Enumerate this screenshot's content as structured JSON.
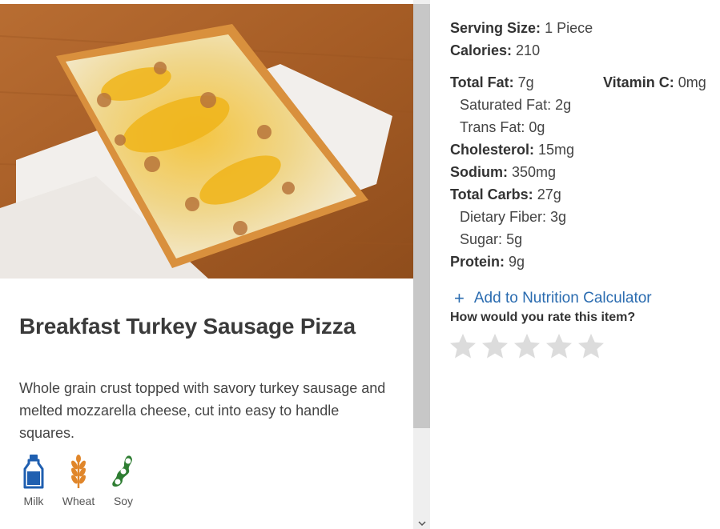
{
  "item": {
    "title": "Breakfast Turkey Sausage Pizza",
    "description": "Whole grain crust topped with savory turkey sausage and melted mozzarella cheese, cut into easy to handle squares.",
    "photo_icon": "pizza-photo"
  },
  "allergens": [
    {
      "label": "Milk",
      "icon": "milk-bottle-icon",
      "color": "#1f5fb0"
    },
    {
      "label": "Wheat",
      "icon": "wheat-icon",
      "color": "#e0862a"
    },
    {
      "label": "Soy",
      "icon": "soybean-icon",
      "color": "#2e7d32"
    }
  ],
  "nutrition": {
    "serving_size": {
      "label": "Serving Size:",
      "value": "1 Piece"
    },
    "calories": {
      "label": "Calories:",
      "value": "210"
    },
    "total_fat": {
      "label": "Total Fat:",
      "value": "7g"
    },
    "vitamin_c": {
      "label": "Vitamin C:",
      "value": "0mg"
    },
    "saturated_fat": {
      "label": "Saturated Fat:",
      "value": "2g"
    },
    "trans_fat": {
      "label": "Trans Fat:",
      "value": "0g"
    },
    "cholesterol": {
      "label": "Cholesterol:",
      "value": "15mg"
    },
    "sodium": {
      "label": "Sodium:",
      "value": "350mg"
    },
    "total_carbs": {
      "label": "Total Carbs:",
      "value": "27g"
    },
    "dietary_fiber": {
      "label": "Dietary Fiber:",
      "value": "3g"
    },
    "sugar": {
      "label": "Sugar:",
      "value": "5g"
    },
    "protein": {
      "label": "Protein:",
      "value": "9g"
    }
  },
  "actions": {
    "add_calculator_icon": "+",
    "add_calculator_label": "Add to Nutrition Calculator",
    "rate_question": "How would you rate this item?",
    "rating": 0,
    "max_rating": 5
  },
  "colors": {
    "link": "#2b6cb0",
    "star_empty": "#dcdcdc"
  }
}
